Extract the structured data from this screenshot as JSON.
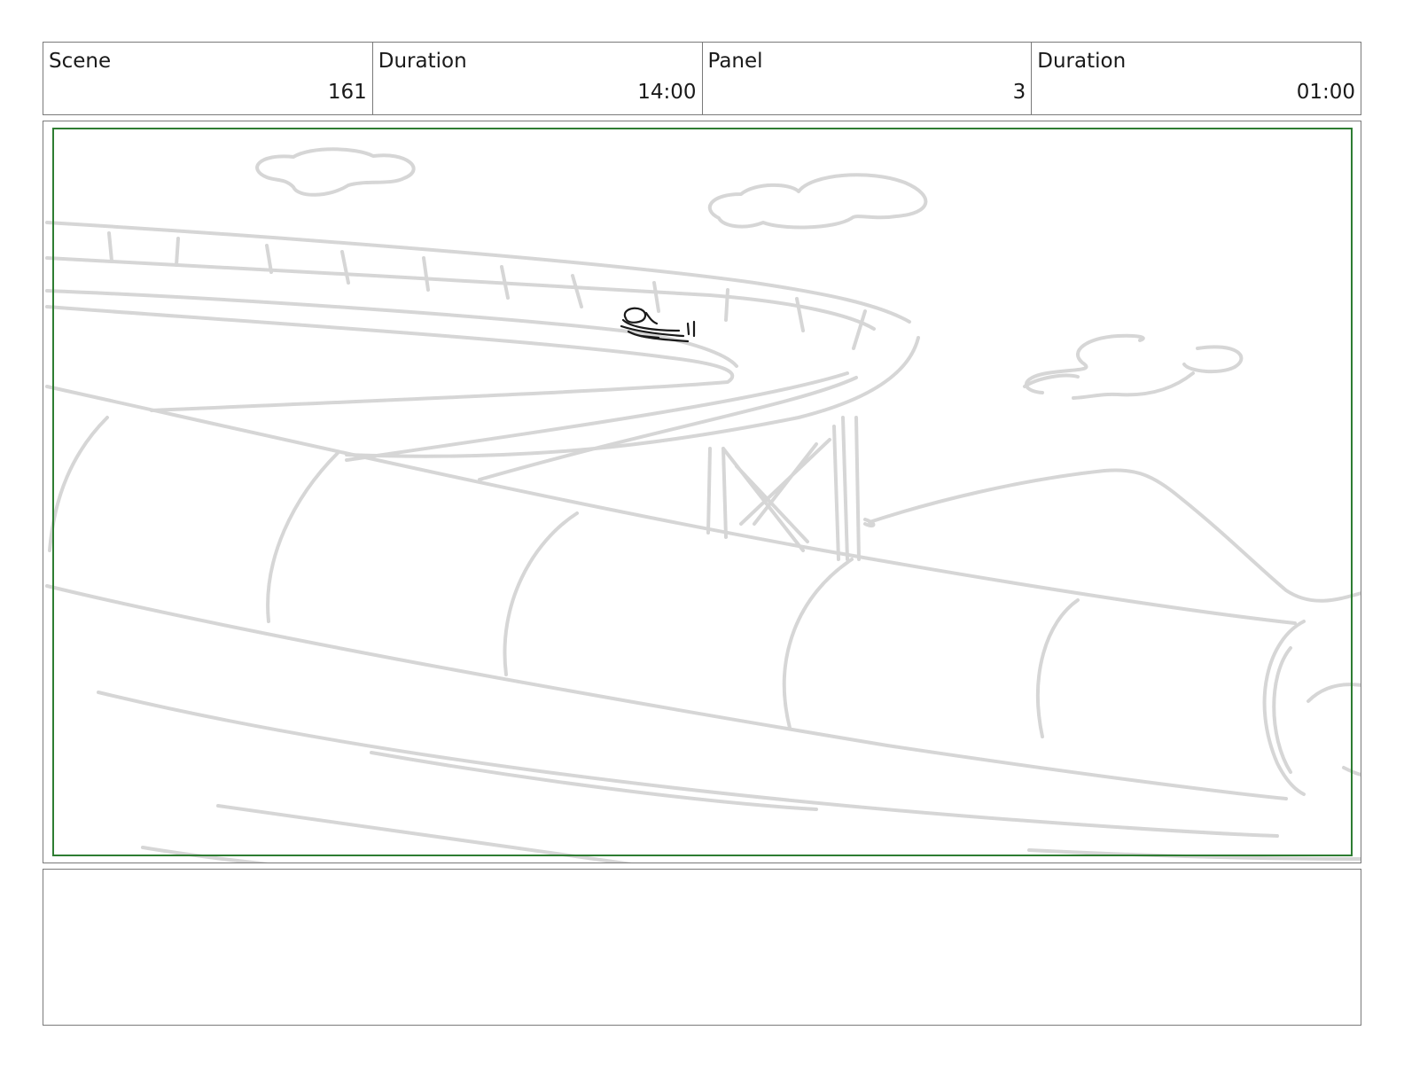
{
  "header": {
    "cells": [
      {
        "label": "Scene",
        "value": "161"
      },
      {
        "label": "Duration",
        "value": "14:00"
      },
      {
        "label": "Panel",
        "value": "3"
      },
      {
        "label": "Duration",
        "value": "01:00"
      }
    ]
  },
  "panel": {
    "sketch_color": "#d6d6d6",
    "figure_color": "#1a1a1a",
    "safe_frame_color": "#2e7d32"
  },
  "notes": {
    "text": ""
  }
}
